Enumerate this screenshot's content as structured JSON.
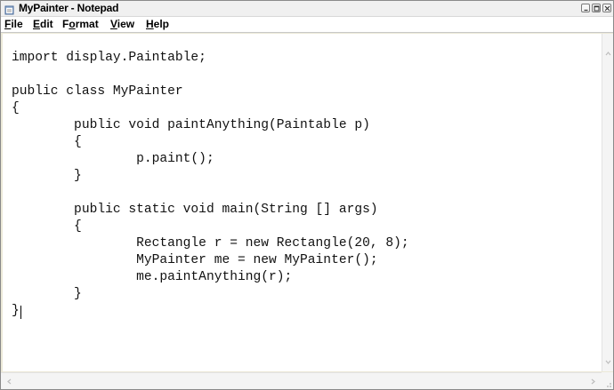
{
  "window": {
    "title": "MyPainter - Notepad",
    "icon": "notepad-icon",
    "controls": [
      "minimize-icon",
      "maximize-icon",
      "close-icon"
    ]
  },
  "menu": {
    "items": [
      {
        "label": "File",
        "accel": "F",
        "rest": "ile"
      },
      {
        "label": "Edit",
        "accel": "E",
        "rest": "dit"
      },
      {
        "label": "Format",
        "pre": "F",
        "accel": "o",
        "rest": "rmat"
      },
      {
        "label": "View",
        "accel": "V",
        "rest": "iew"
      },
      {
        "label": "Help",
        "accel": "H",
        "rest": "elp"
      }
    ]
  },
  "editor": {
    "lines": [
      "import display.Paintable;",
      "",
      "public class MyPainter",
      "{",
      "        public void paintAnything(Paintable p)",
      "        {",
      "                p.paint();",
      "        }",
      "",
      "        public static void main(String [] args)",
      "        {",
      "                Rectangle r = new Rectangle(20, 8);",
      "                MyPainter me = new MyPainter();",
      "                me.paintAnything(r);",
      "        }",
      "}"
    ]
  },
  "scrollbars": {
    "vertical": [
      "scroll-up-icon",
      "scroll-down-icon"
    ],
    "horizontal": [
      "scroll-left-icon",
      "scroll-right-icon"
    ]
  }
}
